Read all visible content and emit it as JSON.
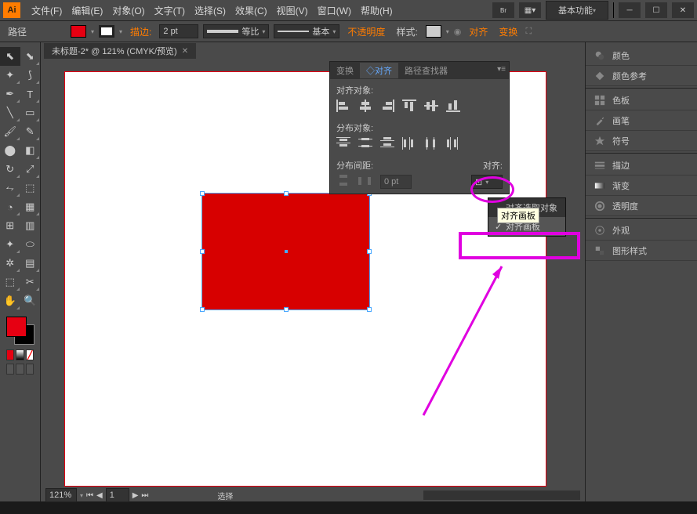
{
  "app": {
    "logo": "Ai"
  },
  "menu": [
    "文件(F)",
    "编辑(E)",
    "对象(O)",
    "文字(T)",
    "选择(S)",
    "效果(C)",
    "视图(V)",
    "窗口(W)",
    "帮助(H)"
  ],
  "workspace": "基本功能",
  "control": {
    "path_label": "路径",
    "fill_color": "#e60012",
    "stroke_label": "描边:",
    "stroke_width": "2 pt",
    "profile_label": "等比",
    "style_label": "基本",
    "opacity_label": "不透明度",
    "style2_label": "样式:",
    "align_label": "对齐",
    "transform_label": "变换"
  },
  "document": {
    "tab_title": "未标题-2* @ 121% (CMYK/预览)"
  },
  "status": {
    "zoom": "121%",
    "page": "1",
    "mode": "选择"
  },
  "align_panel": {
    "tabs": [
      "变换",
      "◇对齐",
      "路径查找器"
    ],
    "sec1": "对齐对象:",
    "sec2": "分布对象:",
    "sec3": "分布间距:",
    "sec3r": "对齐:",
    "spacing": "0 pt",
    "tooltip": "对齐画板",
    "dd_items": [
      "对齐选取对象",
      "对齐画板"
    ]
  },
  "right_panels": [
    "颜色",
    "颜色参考",
    "色板",
    "画笔",
    "符号",
    "描边",
    "渐变",
    "透明度",
    "外观",
    "图形样式"
  ]
}
